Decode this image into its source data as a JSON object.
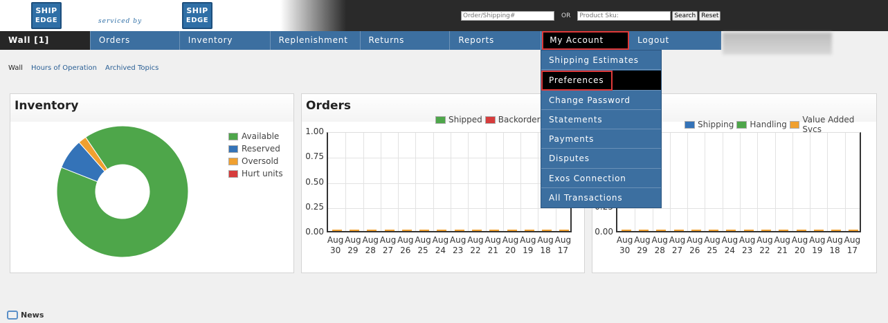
{
  "header": {
    "logo_line1": "SHIP",
    "logo_line2": "EDGE",
    "serviced_by": "serviced by",
    "order_placeholder": "Order/Shipping#",
    "or_label": "OR",
    "sku_placeholder": "Product Sku:",
    "search_label": "Search",
    "reset_label": "Reset"
  },
  "nav": {
    "items": [
      "Wall [1]",
      "Orders",
      "Inventory",
      "Replenishment",
      "Returns",
      "Reports",
      "My Account",
      "Logout"
    ]
  },
  "dropdown": {
    "items": [
      "Shipping Estimates",
      "Preferences",
      "Change Password",
      "Statements",
      "Payments",
      "Disputes",
      "Exos Connection",
      "All Transactions"
    ]
  },
  "sublinks": [
    "Wall",
    "Hours of Operation",
    "Archived Topics"
  ],
  "panels": {
    "inventory_title": "Inventory",
    "orders_title": "Orders",
    "charges_legend": [
      "Shipping",
      "Handling",
      "Value Added Svcs"
    ]
  },
  "colors": {
    "available": "#4ea64a",
    "reserved": "#3473b8",
    "oversold": "#f0a030",
    "hurt": "#d63c3c",
    "shipped": "#4ea64a",
    "backorders": "#d63c3c"
  },
  "news_label": "News",
  "chart_data": [
    {
      "type": "pie",
      "title": "Inventory",
      "labels": [
        "Available",
        "Reserved",
        "Oversold",
        "Hurt units"
      ],
      "values": [
        90.5,
        7.5,
        2.0,
        0.0
      ],
      "legend": "right"
    },
    {
      "type": "bar",
      "title": "Orders",
      "categories": [
        "Aug 30",
        "Aug 29",
        "Aug 28",
        "Aug 27",
        "Aug 26",
        "Aug 25",
        "Aug 24",
        "Aug 23",
        "Aug 22",
        "Aug 21",
        "Aug 20",
        "Aug 19",
        "Aug 18",
        "Aug 17"
      ],
      "series": [
        {
          "name": "Shipped",
          "values": [
            0,
            0,
            0,
            0,
            0,
            0,
            0,
            0,
            0,
            0,
            0,
            0,
            0,
            0
          ]
        },
        {
          "name": "Backorders",
          "values": [
            0,
            0,
            0,
            0,
            0,
            0,
            0,
            0,
            0,
            0,
            0,
            0,
            0,
            0
          ]
        }
      ],
      "yticks": [
        "1.00",
        "0.75",
        "0.50",
        "0.25",
        "0.00"
      ],
      "ylim": [
        0,
        1
      ],
      "legend": "top-right"
    },
    {
      "type": "bar",
      "categories": [
        "Aug 30",
        "Aug 29",
        "Aug 28",
        "Aug 27",
        "Aug 26",
        "Aug 25",
        "Aug 24",
        "Aug 23",
        "Aug 22",
        "Aug 21",
        "Aug 20",
        "Aug 19",
        "Aug 18",
        "Aug 17"
      ],
      "series": [
        {
          "name": "Shipping",
          "values": [
            0,
            0,
            0,
            0,
            0,
            0,
            0,
            0,
            0,
            0,
            0,
            0,
            0,
            0
          ]
        },
        {
          "name": "Handling",
          "values": [
            0,
            0,
            0,
            0,
            0,
            0,
            0,
            0,
            0,
            0,
            0,
            0,
            0,
            0
          ]
        },
        {
          "name": "Value Added Svcs",
          "values": [
            0,
            0,
            0,
            0,
            0,
            0,
            0,
            0,
            0,
            0,
            0,
            0,
            0,
            0
          ]
        }
      ],
      "yticks": [
        "0.25",
        "0.00"
      ],
      "ylim": [
        0,
        1
      ],
      "legend": "top-right"
    }
  ]
}
